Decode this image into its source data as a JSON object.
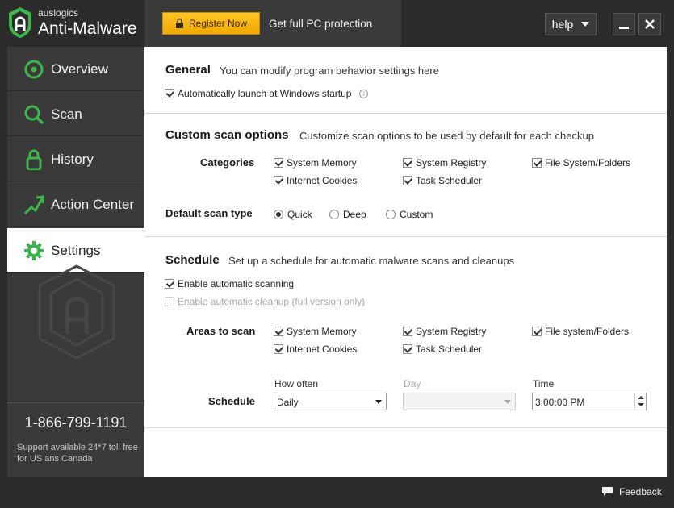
{
  "header": {
    "brand_small": "auslogics",
    "brand_big": "Anti-Malware",
    "register_label": "Register Now",
    "promo_text": "Get full PC protection",
    "help_label": "help"
  },
  "colors": {
    "accent_green": "#3cb54a",
    "register_yellow": "#f7b500",
    "chrome_dark": "#2b2b2b",
    "sidebar": "#3a3a3a"
  },
  "sidebar": {
    "items": [
      {
        "label": "Overview",
        "icon": "overview-icon"
      },
      {
        "label": "Scan",
        "icon": "search-icon"
      },
      {
        "label": "History",
        "icon": "lock-icon"
      },
      {
        "label": "Action Center",
        "icon": "arrows-icon"
      },
      {
        "label": "Settings",
        "icon": "gear-icon",
        "active": true
      }
    ],
    "phone": "1-866-799-1191",
    "support": "Support available 24*7 toll free for US ans Canada"
  },
  "general": {
    "title": "General",
    "desc": "You can modify program behavior settings here",
    "autostart_label": "Automatically launch at Windows startup",
    "autostart_checked": true
  },
  "custom_scan": {
    "title": "Custom scan options",
    "desc": "Customize scan options to be used by default for each checkup",
    "categories_label": "Categories",
    "categories": [
      {
        "label": "System Memory",
        "checked": true
      },
      {
        "label": "System Registry",
        "checked": true
      },
      {
        "label": "File System/Folders",
        "checked": true
      },
      {
        "label": "Internet Cookies",
        "checked": true
      },
      {
        "label": "Task Scheduler",
        "checked": true
      }
    ],
    "scan_type_label": "Default scan type",
    "scan_types": [
      {
        "label": "Quick",
        "selected": true
      },
      {
        "label": "Deep",
        "selected": false
      },
      {
        "label": "Custom",
        "selected": false
      }
    ]
  },
  "schedule": {
    "title": "Schedule",
    "desc": "Set up a schedule for automatic malware scans and cleanups",
    "enable_scanning_label": "Enable automatic scanning",
    "enable_scanning_checked": true,
    "enable_cleanup_label": "Enable automatic cleanup (full version only)",
    "enable_cleanup_checked": false,
    "areas_label": "Areas to scan",
    "areas": [
      {
        "label": "System Memory",
        "checked": true
      },
      {
        "label": "System Registry",
        "checked": true
      },
      {
        "label": "File system/Folders",
        "checked": true
      },
      {
        "label": "Internet Cookies",
        "checked": true
      },
      {
        "label": "Task Scheduler",
        "checked": true
      }
    ],
    "schedule_label": "Schedule",
    "how_often_label": "How often",
    "how_often_value": "Daily",
    "day_label": "Day",
    "day_value": "",
    "time_label": "Time",
    "time_value": "3:00:00 PM"
  },
  "footer": {
    "feedback_label": "Feedback"
  }
}
